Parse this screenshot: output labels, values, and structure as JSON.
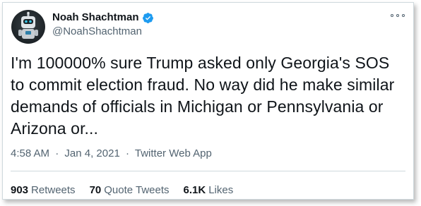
{
  "author": {
    "display_name": "Noah Shachtman",
    "handle": "@NoahShachtman",
    "verified": true,
    "avatar_icon": "robot-avatar-icon",
    "verified_color": "#1d9bf0"
  },
  "tweet": {
    "text": "I'm 100000% sure Trump asked only Georgia's SOS to commit election fraud. No way did he make similar demands of officials in Michigan or Pennsylvania or Arizona or...",
    "time": "4:58 AM",
    "separator": "·",
    "date": "Jan 4, 2021",
    "source": "Twitter Web App"
  },
  "stats": {
    "retweets_count": "903",
    "retweets_label": "Retweets",
    "quotes_count": "70",
    "quotes_label": "Quote Tweets",
    "likes_count": "6.1K",
    "likes_label": "Likes"
  },
  "colors": {
    "text_primary": "#0f1419",
    "text_secondary": "#536471",
    "border": "#cfd9de"
  }
}
